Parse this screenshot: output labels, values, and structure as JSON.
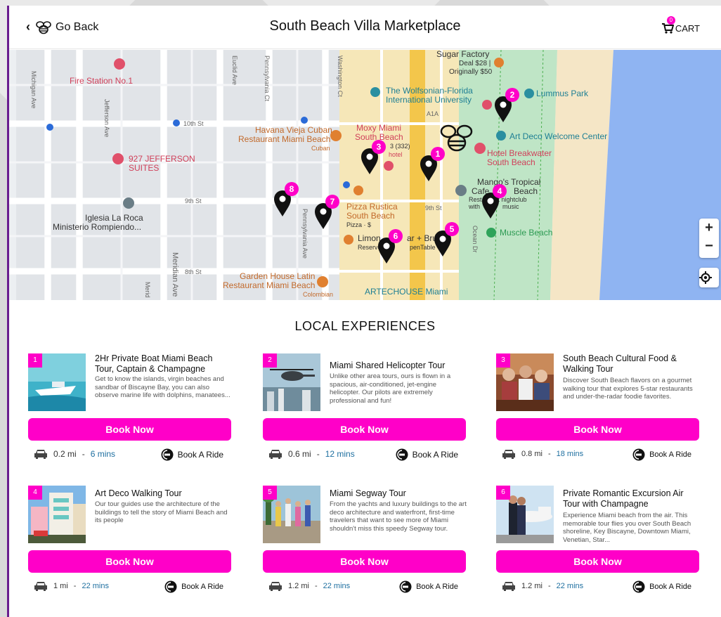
{
  "header": {
    "back_label": "Go Back",
    "title": "South Beach Villa Marketplace",
    "cart_label": "CART",
    "cart_count": "0"
  },
  "map": {
    "labels": {
      "fire_station": "Fire Station No.1",
      "sugar_factory": "Sugar Factory",
      "deal": "Deal $28 |",
      "originally": "Originally $50",
      "wolfsonian_1": "The Wolfsonian-Florida",
      "wolfsonian_2": "International University",
      "lummus": "Lummus Park",
      "art_deco_center": "Art Deco Welcome Center",
      "havana_1": "Havana Vieja Cuban",
      "havana_2": "Restaurant Miami Beach",
      "havana_3": "Cuban",
      "moxy_1": "Moxy Miami",
      "moxy_2": "South Beach",
      "moxy_3": "3 (332)",
      "moxy_4": "hotel",
      "jefferson_1": "927 JEFFERSON",
      "jefferson_2": "SUITES",
      "breakwater_1": "Hotel Breakwater",
      "breakwater_2": "South Beach",
      "mangos_1": "Mango's Tropical",
      "mangos_2": "Cafe",
      "mangos_3": "Beach",
      "mangos_4": "Restaurant nightclub",
      "mangos_5": "with",
      "mangos_6": "music",
      "iglesia_1": "Iglesia La Roca",
      "iglesia_2": "Ministerio Rompiendo...",
      "pizza_1": "Pizza Rustica",
      "pizza_2": "South Beach",
      "pizza_3": "Pizza · $",
      "limon_1": "Limon",
      "limon_2": "ar + Brun",
      "limon_3": "Reserve",
      "limon_4": "penTable",
      "muscle": "Muscle Beach",
      "garden_1": "Garden House Latin",
      "garden_2": "Restaurant Miami Beach",
      "garden_3": "Colombian",
      "artechouse": "ARTECHOUSE Miami"
    },
    "streets": {
      "michigan": "Michigan Ave",
      "jefferson": "Jefferson Ave",
      "euclid": "Euclid Ave",
      "pennsylvania": "Pennsylvania Ct",
      "pennsylvania2": "Pennsylvania Ave",
      "washington": "Washington Ct",
      "tenth": "10th St",
      "ninth": "9th St",
      "ninth2": "9th St",
      "eighth": "8th St",
      "meridian": "Meridian Ave",
      "ocean": "Ocean Dr",
      "a1a": "A1A",
      "merid2": "Merid"
    },
    "zoom_in": "+",
    "zoom_out": "−",
    "pins": [
      "1",
      "2",
      "3",
      "4",
      "5",
      "6",
      "7",
      "8"
    ]
  },
  "section_title": "LOCAL EXPERIENCES",
  "book_label": "Book Now",
  "ride_label": "Book A Ride",
  "experiences": [
    {
      "num": "1",
      "title": "2Hr Private Boat Miami Beach Tour, Captain & Champagne",
      "desc": "Get to know the islands, virgin beaches and sandbar of Biscayne Bay, you can also observe marine life with dolphins, manatees...",
      "distance": "0.2 mi",
      "time": "6 mins"
    },
    {
      "num": "2",
      "title": "Miami Shared Helicopter Tour",
      "desc": "Unlike other area tours, ours is flown in a spacious, air-conditioned, jet-engine helicopter. Our pilots are extremely professional and fun!",
      "distance": "0.6 mi",
      "time": "12 mins"
    },
    {
      "num": "3",
      "title": "South Beach Cultural Food & Walking Tour",
      "desc": "Discover South Beach flavors on a gourmet walking tour that explores 5-star restaurants and under-the-radar foodie favorites.",
      "distance": "0.8 mi",
      "time": "18 mins"
    },
    {
      "num": "4",
      "title": "Art Deco Walking Tour",
      "desc": "Our tour guides use the architecture of the buildings to tell the story of Miami Beach and its people",
      "distance": "1 mi",
      "time": "22 mins"
    },
    {
      "num": "5",
      "title": "Miami Segway Tour",
      "desc": "From the yachts and luxury buildings to the art deco architecture and waterfront, first-time travelers that want to see more of Miami shouldn't miss this speedy Segway tour.",
      "distance": "1.2 mi",
      "time": "22 mins"
    },
    {
      "num": "6",
      "title": "Private Romantic Excursion Air Tour with Champagne",
      "desc": "Experience Miami beach from the air. This memorable tour flies you over South Beach shoreline, Key Biscayne, Downtown Miami, Venetian, Star...",
      "distance": "1.2 mi",
      "time": "22 mins"
    }
  ],
  "colors": {
    "accent": "#ff00c8",
    "brand_border": "#6a1d8f",
    "time_blue": "#1e6fa0"
  }
}
